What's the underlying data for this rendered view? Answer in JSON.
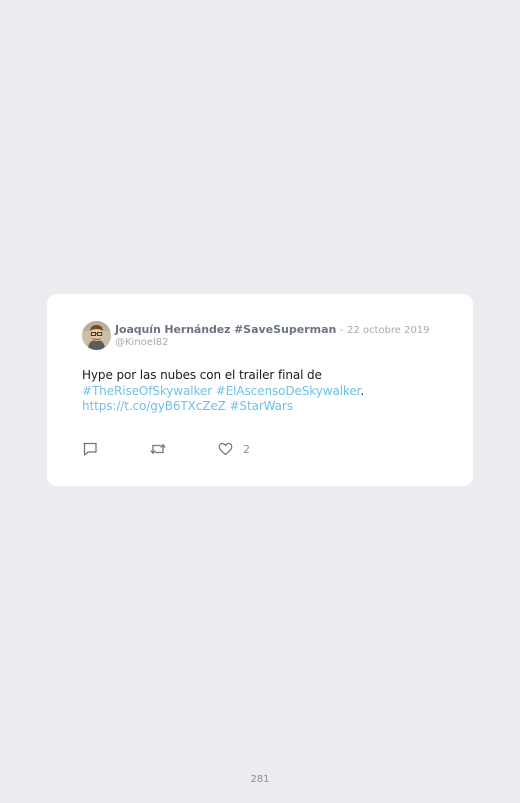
{
  "tweet": {
    "author": {
      "name": "Joaquín Hernández",
      "name_hashtag": "#SaveSuperman",
      "handle": "@Kinoel82",
      "avatar_icon": "user-avatar-cartoon"
    },
    "date_separator": "-",
    "date": "22 octobre 2019",
    "text": {
      "intro": "Hype por las nubes con el trailer final de",
      "hashtag_1": "#TheRiseOfSkywalker",
      "hashtag_2": "#ElAscensoDeSkywalker",
      "period": ".",
      "link": "https://t.co/gyB6TXcZeZ",
      "hashtag_3": "#StarWars"
    },
    "actions": {
      "reply_icon": "reply-icon",
      "retweet_icon": "retweet-icon",
      "like_icon": "heart-icon",
      "like_count": "2"
    },
    "colors": {
      "link": "#6ec0ea",
      "author": "#6b7480",
      "muted": "#a3aab2",
      "background": "#ebebf0",
      "card": "#ffffff"
    }
  },
  "page": {
    "number": "281"
  }
}
